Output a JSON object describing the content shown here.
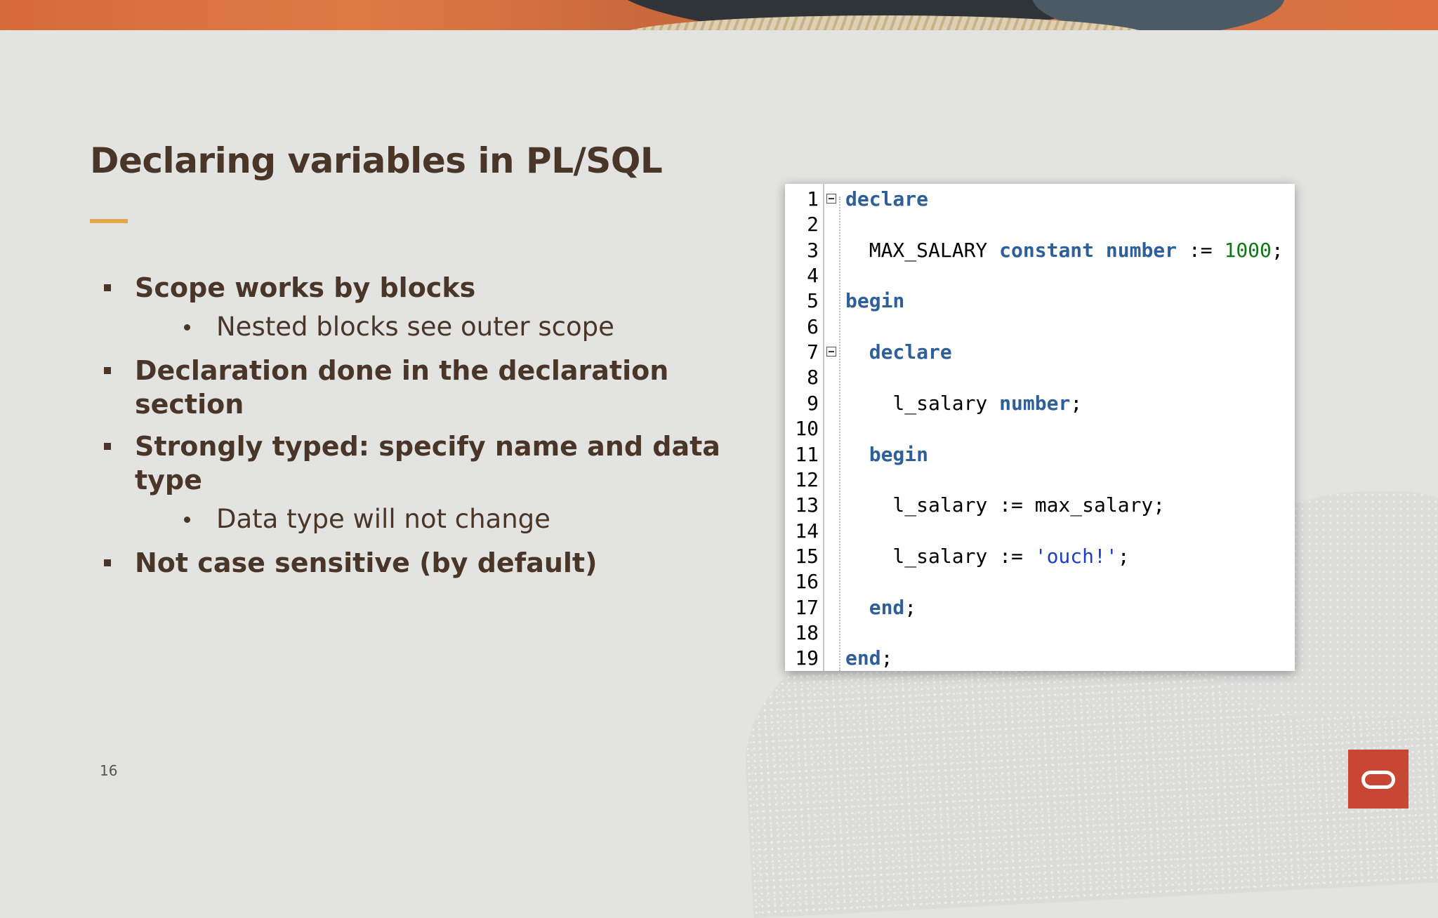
{
  "slide": {
    "title": "Declaring variables in PL/SQL",
    "page_number": "16",
    "accent_color": "#e3a84e",
    "logo_color": "#c74634"
  },
  "bullets": [
    {
      "text": "Scope works by blocks",
      "sub": [
        "Nested blocks see outer scope"
      ]
    },
    {
      "text": "Declaration done in the declaration section",
      "sub": []
    },
    {
      "text": "Strongly typed: specify name and data type",
      "sub": [
        "Data type will not change"
      ]
    },
    {
      "text": "Not case sensitive (by default)",
      "sub": []
    }
  ],
  "code": {
    "keyword_color": "#2f5f99",
    "number_color": "#0b7a10",
    "string_color": "#1b3ec8",
    "fold_icon": "collapse-minus-icon",
    "lines": [
      {
        "n": "1",
        "fold": true,
        "tokens": [
          {
            "t": "declare",
            "k": "kw"
          }
        ]
      },
      {
        "n": "2",
        "tokens": []
      },
      {
        "n": "3",
        "tokens": [
          {
            "t": "  MAX_SALARY ",
            "k": ""
          },
          {
            "t": "constant",
            "k": "kw"
          },
          {
            "t": " ",
            "k": ""
          },
          {
            "t": "number",
            "k": "kw"
          },
          {
            "t": " := ",
            "k": ""
          },
          {
            "t": "1000",
            "k": "num"
          },
          {
            "t": ";",
            "k": ""
          }
        ]
      },
      {
        "n": "4",
        "tokens": []
      },
      {
        "n": "5",
        "tokens": [
          {
            "t": "begin",
            "k": "kw"
          }
        ]
      },
      {
        "n": "6",
        "tokens": []
      },
      {
        "n": "7",
        "fold": true,
        "tokens": [
          {
            "t": "  ",
            "k": ""
          },
          {
            "t": "declare",
            "k": "kw"
          }
        ]
      },
      {
        "n": "8",
        "tokens": []
      },
      {
        "n": "9",
        "tokens": [
          {
            "t": "    l_salary ",
            "k": ""
          },
          {
            "t": "number",
            "k": "kw"
          },
          {
            "t": ";",
            "k": ""
          }
        ]
      },
      {
        "n": "10",
        "tokens": []
      },
      {
        "n": "11",
        "tokens": [
          {
            "t": "  ",
            "k": ""
          },
          {
            "t": "begin",
            "k": "kw"
          }
        ]
      },
      {
        "n": "12",
        "tokens": []
      },
      {
        "n": "13",
        "tokens": [
          {
            "t": "    l_salary := max_salary;",
            "k": ""
          }
        ]
      },
      {
        "n": "14",
        "tokens": []
      },
      {
        "n": "15",
        "tokens": [
          {
            "t": "    l_salary := ",
            "k": ""
          },
          {
            "t": "'ouch!'",
            "k": "str"
          },
          {
            "t": ";",
            "k": ""
          }
        ]
      },
      {
        "n": "16",
        "tokens": []
      },
      {
        "n": "17",
        "tokens": [
          {
            "t": "  ",
            "k": ""
          },
          {
            "t": "end",
            "k": "kw"
          },
          {
            "t": ";",
            "k": ""
          }
        ]
      },
      {
        "n": "18",
        "tokens": []
      },
      {
        "n": "19",
        "tokens": [
          {
            "t": "end",
            "k": "kw"
          },
          {
            "t": ";",
            "k": ""
          }
        ]
      }
    ]
  }
}
